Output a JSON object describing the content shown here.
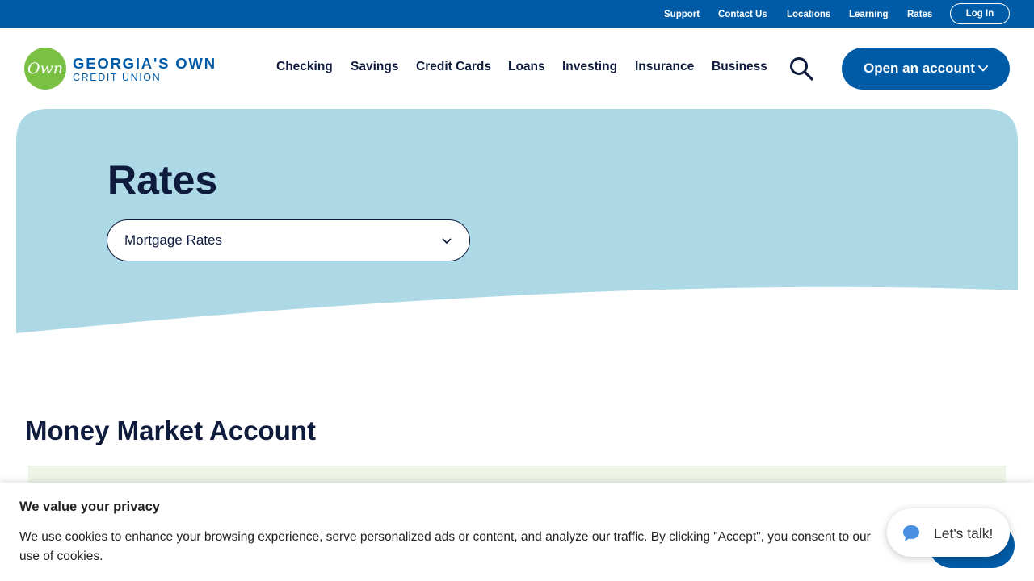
{
  "utility_nav": {
    "links": [
      "Support",
      "Contact Us",
      "Locations",
      "Learning",
      "Rates"
    ],
    "login_label": "Log In"
  },
  "brand": {
    "mark_text": "Own",
    "name": "GEORGIA'S OWN",
    "subtitle": "CREDIT UNION",
    "colors": {
      "primary": "#005ba6",
      "green": "#7ac143",
      "hero": "#add8e6",
      "navy": "#0f1b3d"
    }
  },
  "main_nav": {
    "items": [
      "Checking",
      "Savings",
      "Credit Cards",
      "Loans",
      "Investing",
      "Insurance",
      "Business"
    ],
    "search_icon": "search-icon",
    "cta_label": "Open an account"
  },
  "hero": {
    "title": "Rates",
    "select_value": "Mortgage Rates"
  },
  "section": {
    "title": "Money Market Account"
  },
  "cookie_banner": {
    "title": "We value your privacy",
    "text": "We use cookies to enhance your browsing experience, serve personalized ads or content, and analyze our traffic. By clicking \"Accept\", you consent to our use of cookies."
  },
  "chat": {
    "label": "Let's talk!",
    "icon": "chat-bubble-icon"
  }
}
